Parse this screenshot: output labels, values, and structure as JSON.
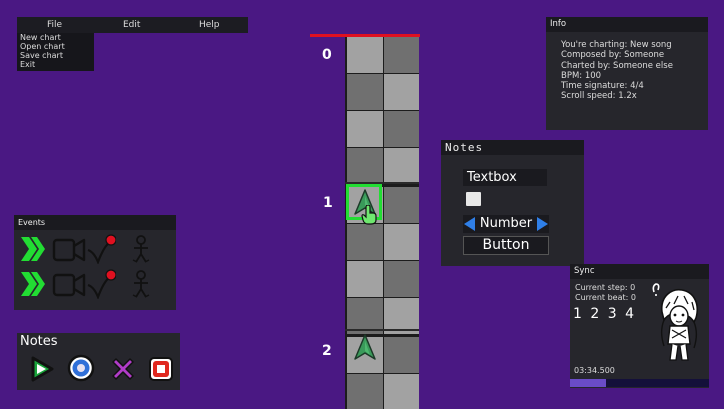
{
  "menu": {
    "titles": [
      "File",
      "Edit",
      "Help"
    ],
    "items": [
      "New chart",
      "Open chart",
      "Save chart",
      "Exit"
    ]
  },
  "info": {
    "title": "Info",
    "lines": [
      "You're charting: New song",
      "Composed by:  Someone",
      "Charted by: Someone else",
      "BPM: 100",
      "Time signature: 4/4",
      "Scroll speed: 1.2x"
    ]
  },
  "chart": {
    "beat_labels": [
      "0",
      "1",
      "2"
    ]
  },
  "widgets": {
    "title": "Notes",
    "textbox": "Textbox",
    "number_label": "Number",
    "button_label": "Button"
  },
  "events": {
    "title": "Events",
    "icons": [
      "double-chevron-icon",
      "camera-icon",
      "microphone-icon",
      "character-icon"
    ]
  },
  "notes_palette": {
    "title": "Notes",
    "icons": [
      "triangle-note-icon",
      "circle-note-icon",
      "cross-note-icon",
      "square-note-icon"
    ]
  },
  "sync": {
    "title": "Sync",
    "current_step": "Current step: 0",
    "current_beat": "Current beat: 0",
    "count": "1 2 3 4",
    "time": "03:34.500",
    "progress": 0.26
  },
  "colors": {
    "background": "#4a1883",
    "panel": "#26262c",
    "accent_green": "#22dd33",
    "accent_blue": "#2f7fe8",
    "chart_red": "#e01020"
  }
}
